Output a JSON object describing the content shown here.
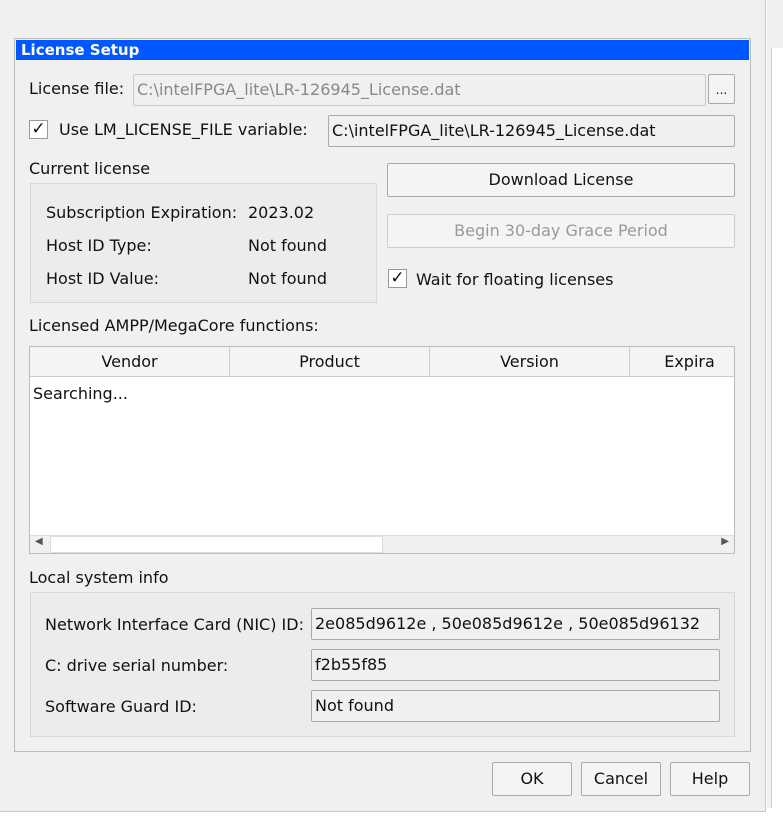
{
  "dialog": {
    "title": "License Setup"
  },
  "license_file": {
    "label": "License file:",
    "value": "C:\\intelFPGA_lite\\LR-126945_License.dat",
    "browse_label": "..."
  },
  "lm_license": {
    "checked": true,
    "check_glyph": "✓",
    "label": "Use LM_LICENSE_FILE variable:",
    "value": "C:\\intelFPGA_lite\\LR-126945_License.dat"
  },
  "current_license": {
    "heading": "Current license",
    "rows": [
      {
        "label": "Subscription Expiration:",
        "value": "2023.02"
      },
      {
        "label": "Host ID Type:",
        "value": "Not found"
      },
      {
        "label": "Host ID Value:",
        "value": "Not found"
      }
    ]
  },
  "buttons": {
    "download": "Download License",
    "grace": "Begin 30-day Grace Period",
    "ok": "OK",
    "cancel": "Cancel",
    "help": "Help"
  },
  "wait_floating": {
    "checked": true,
    "label": "Wait for floating licenses"
  },
  "functions": {
    "heading": "Licensed AMPP/MegaCore functions:",
    "columns": [
      "Vendor",
      "Product",
      "Version",
      "Expira"
    ],
    "status": "Searching..."
  },
  "local_info": {
    "heading": "Local system info",
    "rows": [
      {
        "label": "Network Interface Card (NIC) ID:",
        "value": "2e085d9612e , 50e085d9612e , 50e085d96132"
      },
      {
        "label": "C: drive serial number:",
        "value": "f2b55f85"
      },
      {
        "label": "Software Guard ID:",
        "value": "Not found"
      }
    ]
  }
}
